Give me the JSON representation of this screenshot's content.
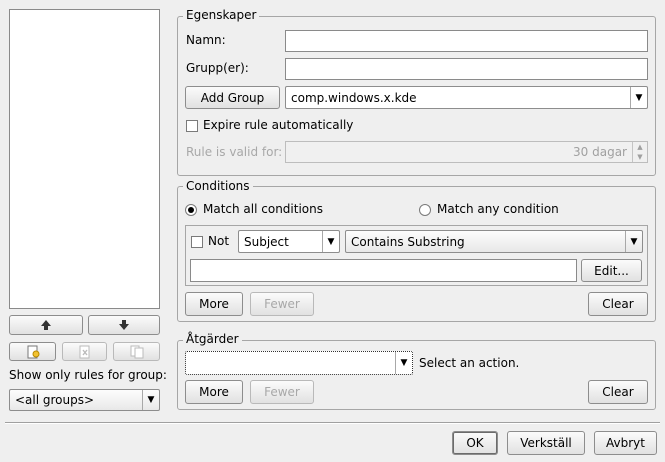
{
  "left": {
    "group_filter_label": "Show only rules for group:",
    "group_filter_value": "<all groups>"
  },
  "properties": {
    "title": "Egenskaper",
    "name_label": "Namn:",
    "name_value": "",
    "groups_label": "Grupp(er):",
    "groups_value": "",
    "add_group_label": "Add Group",
    "group_combo_value": "comp.windows.x.kde",
    "expire_label": "Expire rule automatically",
    "valid_for_label": "Rule is valid for:",
    "valid_for_value": "30 dagar"
  },
  "conditions": {
    "title": "Conditions",
    "match_all_label": "Match all conditions",
    "match_any_label": "Match any condition",
    "not_label": "Not",
    "field_value": "Subject",
    "operator_value": "Contains Substring",
    "pattern_value": "",
    "edit_label": "Edit...",
    "more_label": "More",
    "fewer_label": "Fewer",
    "clear_label": "Clear"
  },
  "actions": {
    "title": "Åtgärder",
    "action_value": "",
    "hint": "Select an action.",
    "more_label": "More",
    "fewer_label": "Fewer",
    "clear_label": "Clear"
  },
  "footer": {
    "ok_label": "OK",
    "apply_label": "Verkställ",
    "cancel_label": "Avbryt"
  }
}
